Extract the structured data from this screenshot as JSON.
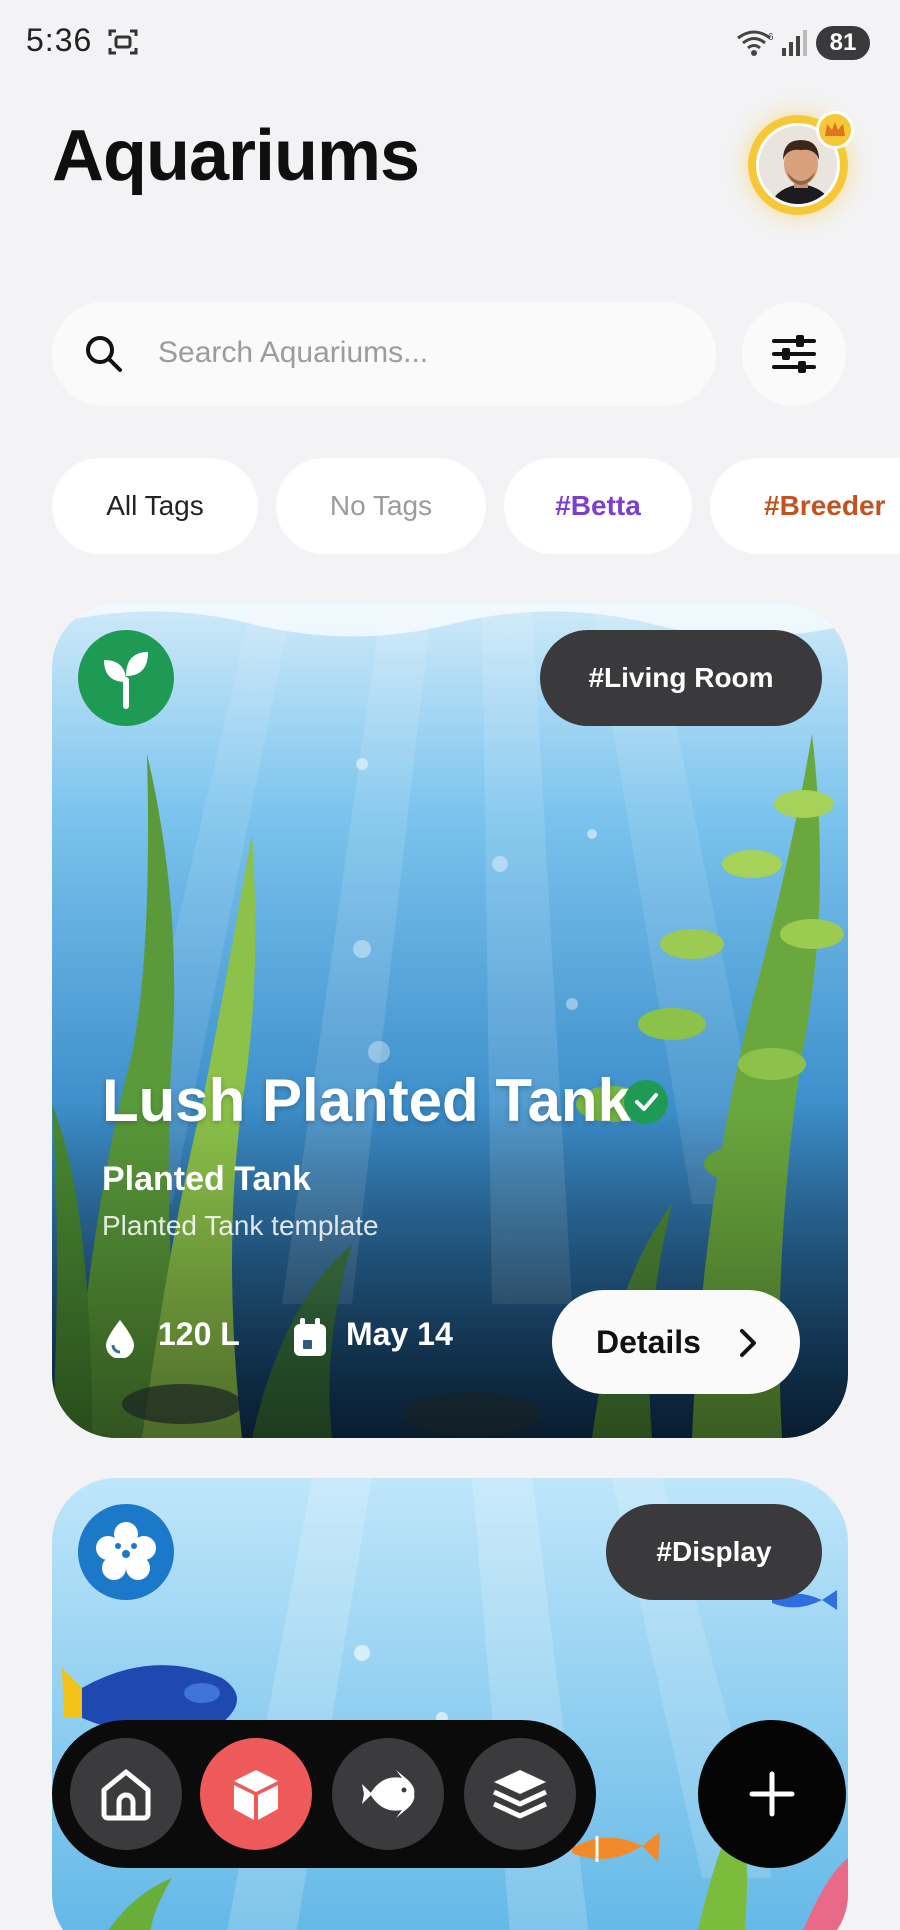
{
  "status_bar": {
    "time": "5:36",
    "battery": "81",
    "icons": [
      "screenshot-icon",
      "wifi-icon",
      "signal-icon",
      "battery-icon"
    ]
  },
  "header": {
    "title": "Aquariums",
    "avatar_badge": "crown-icon"
  },
  "search": {
    "placeholder": "Search Aquariums...",
    "filter_icon": "sliders-icon"
  },
  "tags": [
    {
      "label": "All Tags",
      "color": "#222222"
    },
    {
      "label": "No Tags",
      "color": "#9a9aa0"
    },
    {
      "label": "#Betta",
      "color": "#7b3fd0"
    },
    {
      "label": "#Breeder",
      "color": "#c4521f"
    }
  ],
  "aquariums": [
    {
      "icon": "sprout-icon",
      "icon_color": "#1f9a55",
      "tag": "#Living Room",
      "name": "Lush Planted Tank",
      "verified": true,
      "type": "Planted Tank",
      "template": "Planted Tank template",
      "volume": "120 L",
      "date": "May 14",
      "details_label": "Details"
    },
    {
      "icon": "flower-icon",
      "icon_color": "#1c78c8",
      "tag": "#Display"
    }
  ],
  "bottom_nav": {
    "items": [
      "home-icon",
      "tank-cube-icon",
      "fish-icon",
      "layers-icon"
    ],
    "active_index": 1,
    "active_color": "#ee5a5a"
  },
  "fab": {
    "icon": "plus-icon"
  }
}
